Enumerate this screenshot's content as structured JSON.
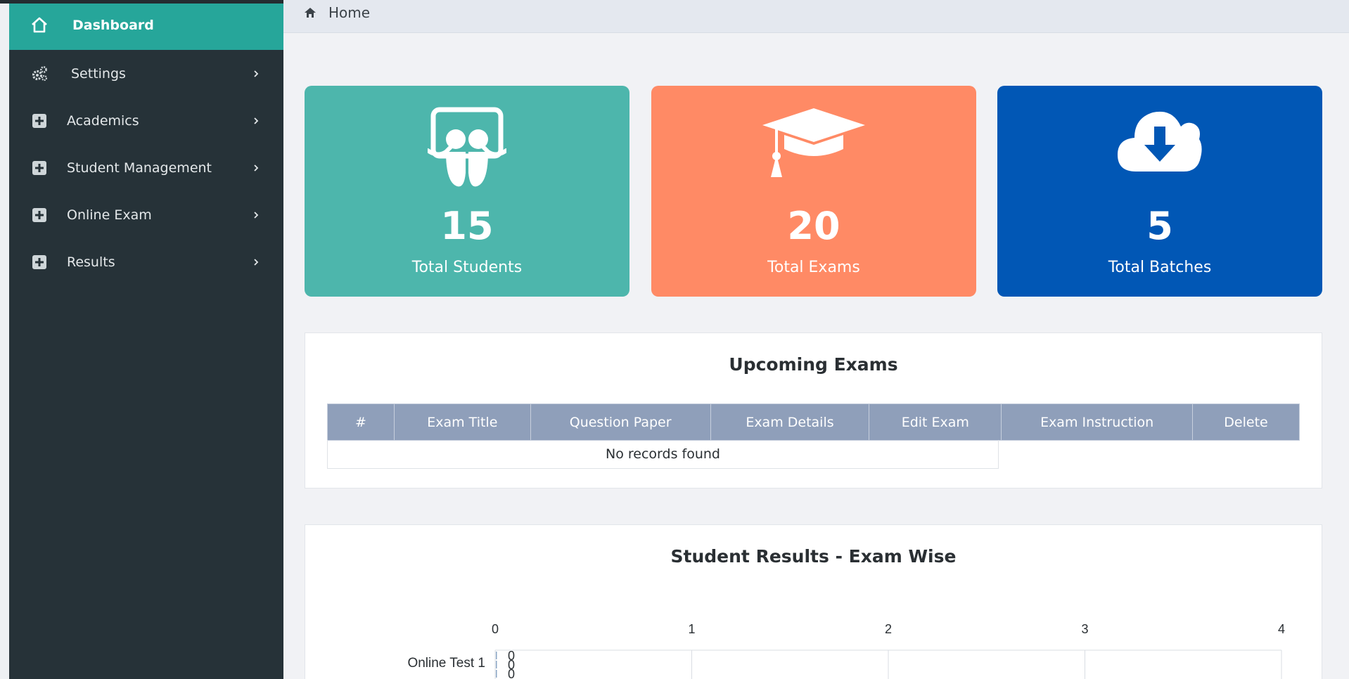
{
  "sidebar": {
    "items": [
      {
        "label": "Dashboard",
        "icon": "home-icon",
        "active": true
      },
      {
        "label": "Settings",
        "icon": "gears-icon"
      },
      {
        "label": "Academics",
        "icon": "plus-square-icon"
      },
      {
        "label": "Student Management",
        "icon": "plus-square-icon"
      },
      {
        "label": "Online Exam",
        "icon": "plus-square-icon"
      },
      {
        "label": "Results",
        "icon": "plus-square-icon"
      }
    ]
  },
  "breadcrumb": {
    "label": "Home",
    "icon": "home-icon"
  },
  "stats": [
    {
      "value": "15",
      "label": "Total Students",
      "color": "#4db6ac",
      "icon": "slideshare-icon"
    },
    {
      "value": "20",
      "label": "Total Exams",
      "color": "#ff8a65",
      "icon": "graduation-cap-icon"
    },
    {
      "value": "5",
      "label": "Total Batches",
      "color": "#0157b5",
      "icon": "cloud-download-icon"
    }
  ],
  "upcoming": {
    "title": "Upcoming Exams",
    "columns": [
      "#",
      "Exam Title",
      "Question Paper",
      "Exam Details",
      "Edit Exam",
      "Exam Instruction",
      "Delete"
    ],
    "empty_text": "No records found",
    "header_color": "#8f9fba"
  },
  "results": {
    "title": "Student Results - Exam Wise"
  },
  "chart_data": {
    "type": "bar",
    "orientation": "horizontal",
    "title": "Student Results - Exam Wise",
    "categories": [
      "Online Test 1"
    ],
    "series": [
      {
        "values": [
          0
        ]
      },
      {
        "values": [
          0
        ]
      },
      {
        "values": [
          0
        ]
      }
    ],
    "data_labels": [
      "0",
      "0",
      "0"
    ],
    "xlim": [
      0,
      4
    ],
    "xticks": [
      "0",
      "1",
      "2",
      "3",
      "4"
    ],
    "axis_position": "top",
    "grid": true
  },
  "colors": {
    "sidebar_bg": "#263238",
    "sidebar_active": "#26a69a",
    "page_bg": "#f1f2f5"
  }
}
